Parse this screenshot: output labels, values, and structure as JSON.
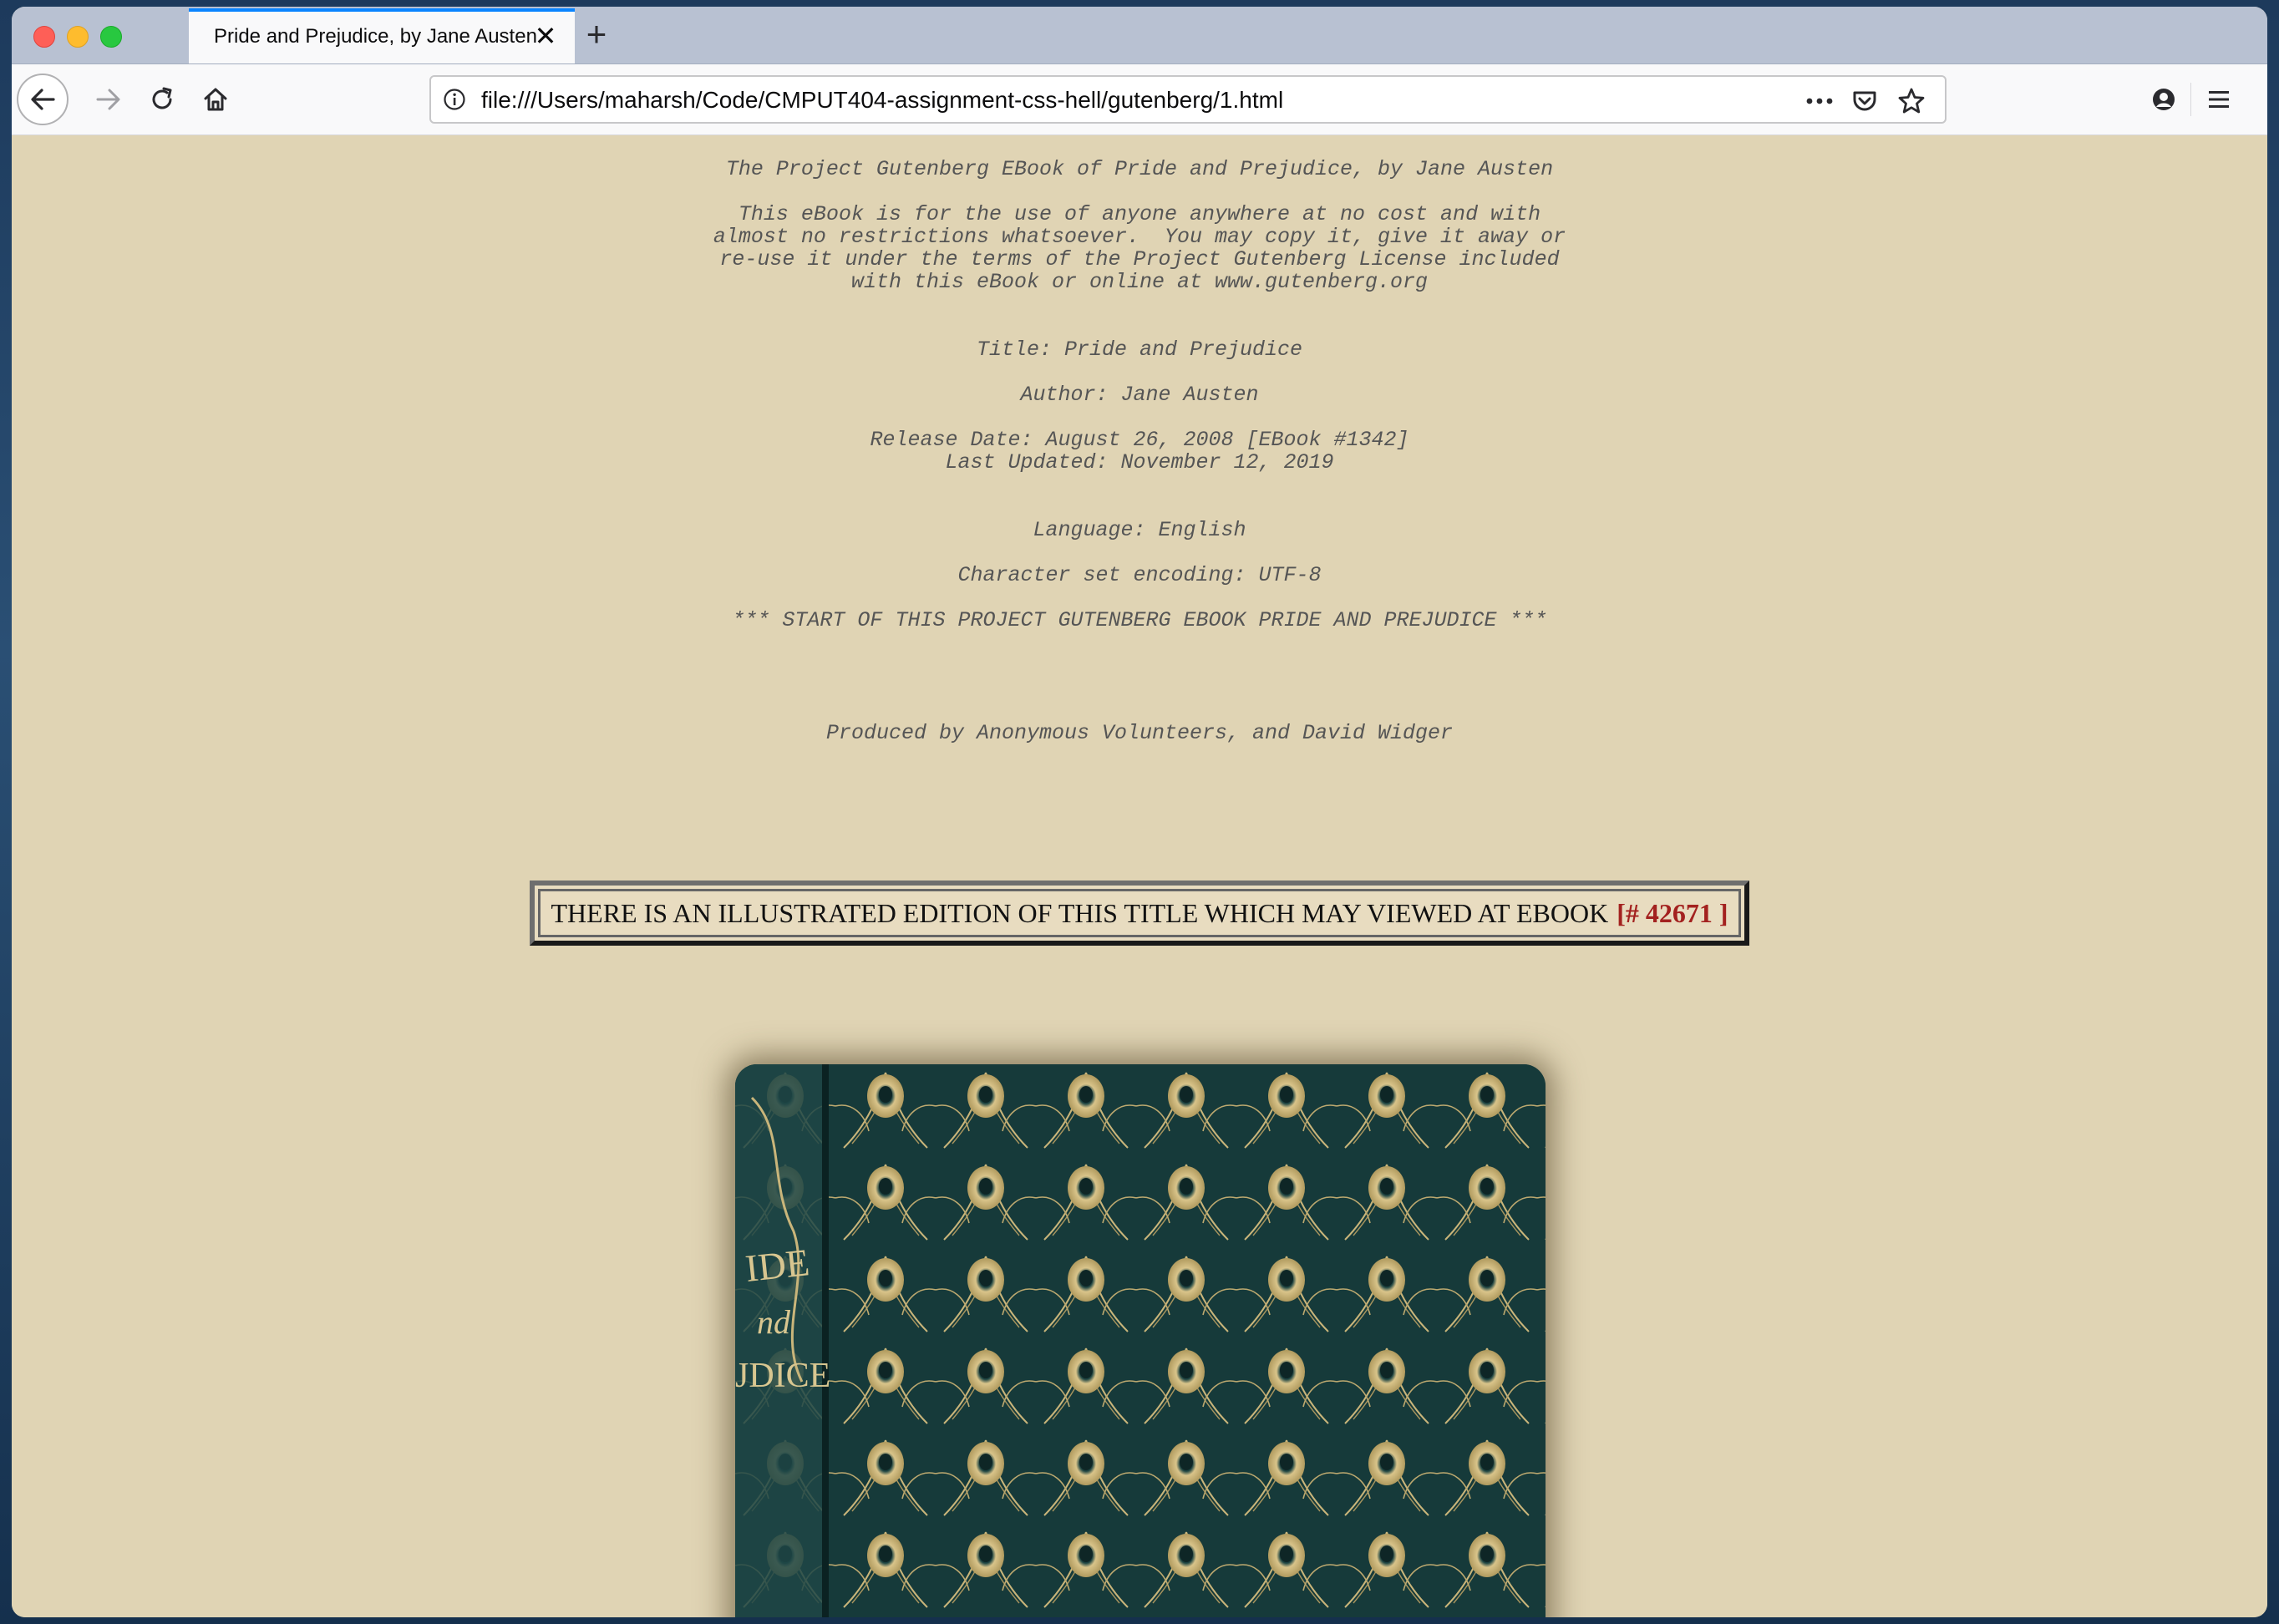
{
  "browser": {
    "tab": {
      "title": "Pride and Prejudice, by Jane Austen"
    },
    "url": "file:///Users/maharsh/Code/CMPUT404-assignment-css-hell/gutenberg/1.html",
    "icons": {
      "close": "close-icon",
      "new_tab": "plus-icon",
      "back": "back-arrow-icon",
      "forward": "forward-arrow-icon",
      "reload": "reload-icon",
      "home": "home-icon",
      "info": "info-icon",
      "more": "more-icon",
      "pocket": "pocket-icon",
      "bookmark": "star-icon",
      "account": "account-icon",
      "menu": "hamburger-menu-icon"
    }
  },
  "page": {
    "header_line": "The Project Gutenberg EBook of Pride and Prejudice, by Jane Austen",
    "license_text": "This eBook is for the use of anyone anywhere at no cost and with\nalmost no restrictions whatsoever.  You may copy it, give it away or\nre-use it under the terms of the Project Gutenberg License included\nwith this eBook or online at www.gutenberg.org",
    "title_line": "Title: Pride and Prejudice",
    "author_line": "Author: Jane Austen",
    "release_lines": "Release Date: August 26, 2008 [EBook #1342]\nLast Updated: November 12, 2019",
    "language_line": "Language: English",
    "charset_line": "Character set encoding: UTF-8",
    "start_line": "*** START OF THIS PROJECT GUTENBERG EBOOK PRIDE AND PREJUDICE ***",
    "produced_line": "Produced by Anonymous Volunteers, and David Widger",
    "notice_text": "THERE IS AN ILLUSTRATED EDITION OF THIS TITLE WHICH MAY VIEWED AT EBOOK",
    "notice_link": "[# 42671 ]",
    "cover_image": "book-cover-peacock-feathers",
    "cover_spine_text": "IDE\nnd\nJDICE"
  },
  "colors": {
    "page_background": "#e0d4b4",
    "link": "#a3211f",
    "tab_accent": "#0a84ff"
  }
}
